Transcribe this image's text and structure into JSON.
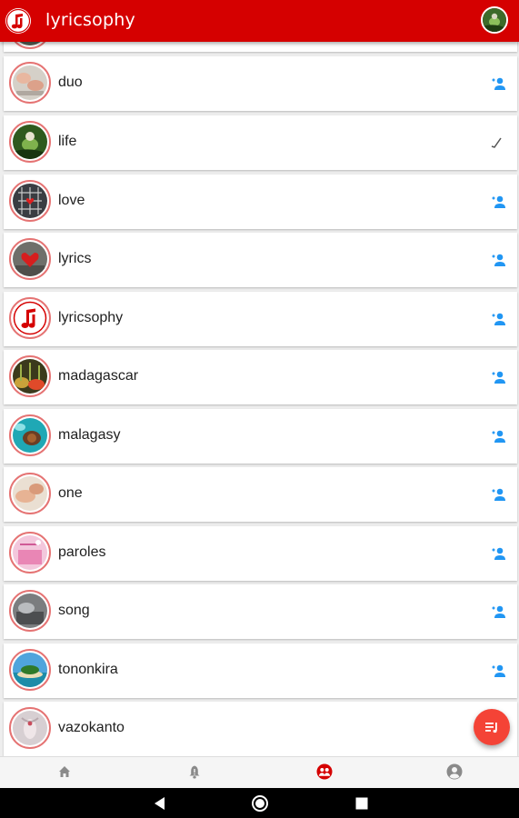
{
  "app": {
    "title": "lyricsophy"
  },
  "colors": {
    "primary": "#d50000",
    "accent": "#2196f3",
    "fab": "#f44336",
    "avatar_ring": "#e57373"
  },
  "tags": [
    {
      "name": "duo",
      "followed": false,
      "action_icon": "person-add-icon"
    },
    {
      "name": "life",
      "followed": true,
      "action_icon": "check-icon"
    },
    {
      "name": "love",
      "followed": false,
      "action_icon": "person-add-icon"
    },
    {
      "name": "lyrics",
      "followed": false,
      "action_icon": "person-add-icon"
    },
    {
      "name": "lyricsophy",
      "followed": false,
      "action_icon": "person-add-icon"
    },
    {
      "name": "madagascar",
      "followed": false,
      "action_icon": "person-add-icon"
    },
    {
      "name": "malagasy",
      "followed": false,
      "action_icon": "person-add-icon"
    },
    {
      "name": "one",
      "followed": false,
      "action_icon": "person-add-icon"
    },
    {
      "name": "paroles",
      "followed": false,
      "action_icon": "person-add-icon"
    },
    {
      "name": "song",
      "followed": false,
      "action_icon": "person-add-icon"
    },
    {
      "name": "tononkira",
      "followed": false,
      "action_icon": "person-add-icon"
    },
    {
      "name": "vazokanto",
      "followed": false,
      "action_icon": "person-add-icon"
    }
  ],
  "bottom_nav": [
    {
      "icon": "home-icon",
      "active": false
    },
    {
      "icon": "bell-icon",
      "active": false
    },
    {
      "icon": "group-icon",
      "active": true
    },
    {
      "icon": "account-circle-icon",
      "active": false
    }
  ],
  "fab": {
    "icon": "playlist-icon"
  },
  "system_nav": [
    {
      "icon": "back-icon"
    },
    {
      "icon": "home-circle-icon"
    },
    {
      "icon": "recents-icon"
    }
  ]
}
